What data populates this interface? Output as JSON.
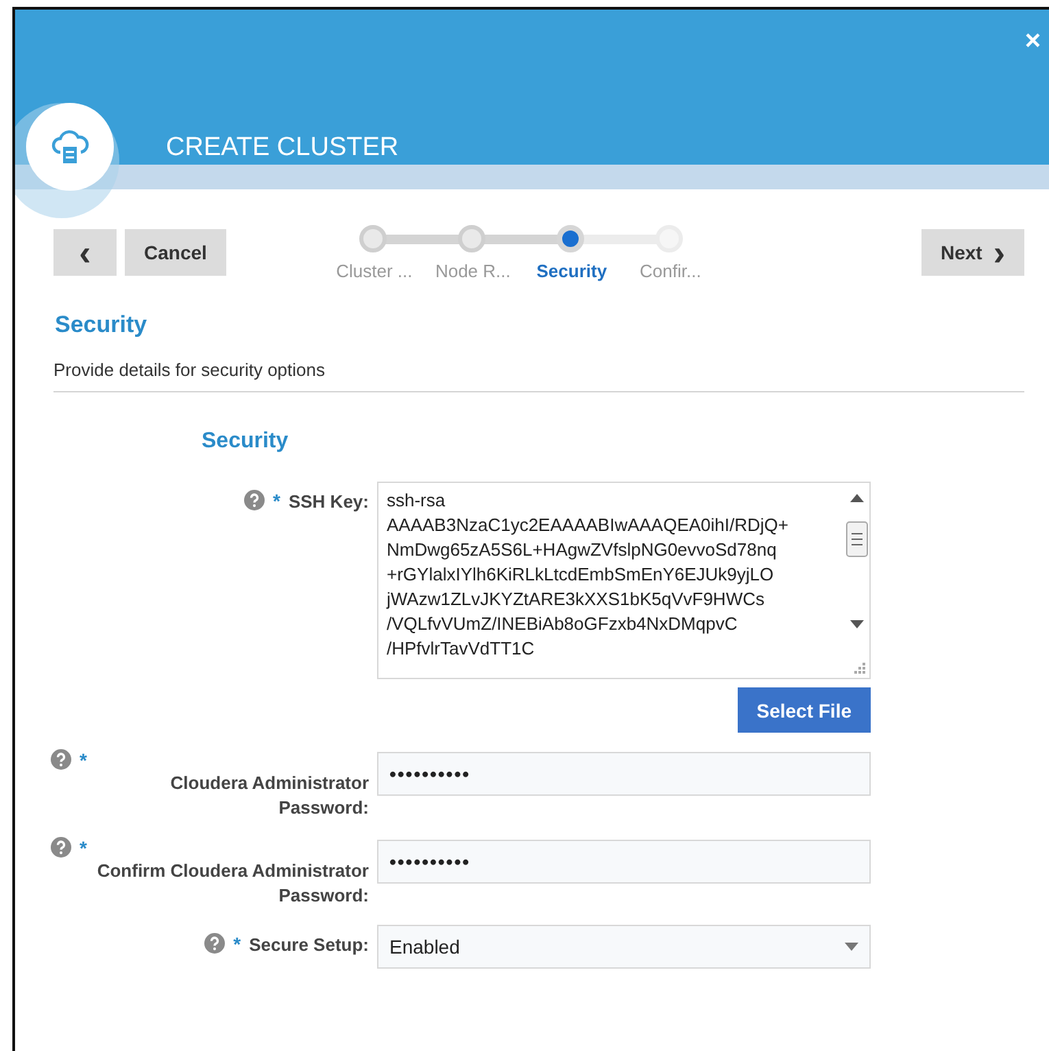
{
  "window": {
    "title": "CREATE CLUSTER",
    "close": "×"
  },
  "nav": {
    "back": "‹",
    "cancel": "Cancel",
    "next": "Next",
    "next_icon": "›"
  },
  "steps": [
    {
      "label": "Cluster ...",
      "completed": true,
      "selected": false
    },
    {
      "label": "Node R...",
      "completed": true,
      "selected": false
    },
    {
      "label": "Security",
      "completed": false,
      "selected": true
    },
    {
      "label": "Confir...",
      "completed": false,
      "selected": false
    }
  ],
  "page": {
    "heading": "Security",
    "description": "Provide details for security options"
  },
  "section": {
    "heading": "Security"
  },
  "fields": [
    {
      "kind": "textarea",
      "label": "SSH Key:",
      "required_mark": "*",
      "lines": [
        "ssh-rsa",
        "AAAAB3NzaC1yc2EAAAABIwAAAQEA0ihI/RDjQ+",
        "NmDwg65zA5S6L+HAgwZVfslpNG0evvoSd78nq",
        "+rGYlalxIYlh6KiRLkLtcdEmbSmEnY6EJUk9yjLO",
        "jWAzw1ZLvJKYZtARE3kXXS1bK5qVvF9HWCs",
        "/VQLfvVUmZ/INEBiAb8oGFzxb4NxDMqpvC",
        "/HPfvlrTavVdTT1C"
      ],
      "button": "Select File"
    },
    {
      "kind": "password",
      "label": "Cloudera Administrator Password:",
      "required_mark": "*",
      "value": "••••••••••"
    },
    {
      "kind": "password",
      "label": "Confirm Cloudera Administrator Password:",
      "required_mark": "*",
      "value": "••••••••••"
    },
    {
      "kind": "select",
      "label": "Secure Setup:",
      "required_mark": "*",
      "value": "Enabled"
    }
  ]
}
